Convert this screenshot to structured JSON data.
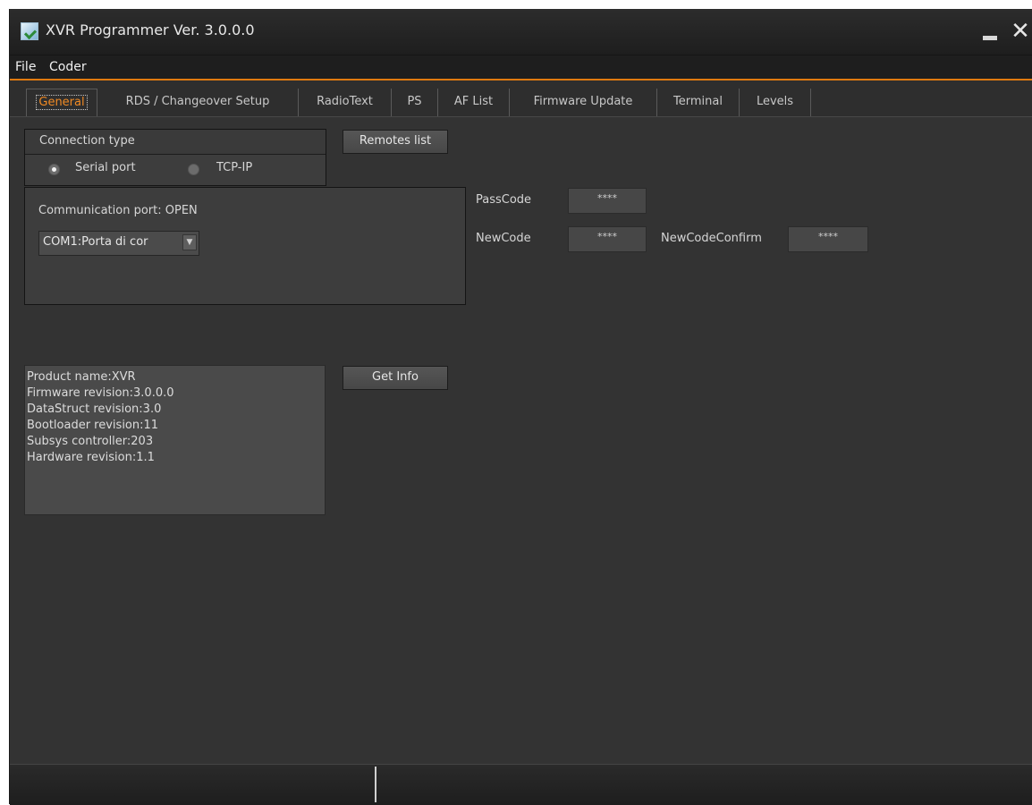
{
  "window": {
    "title": "XVR Programmer  Ver. 3.0.0.0",
    "minimize_glyph": "",
    "close_glyph": "✕"
  },
  "menu": {
    "items": [
      "File",
      "Coder"
    ]
  },
  "tabs": [
    {
      "label": "General",
      "active": true
    },
    {
      "label": "RDS / Changeover Setup",
      "active": false
    },
    {
      "label": "RadioText",
      "active": false
    },
    {
      "label": "PS",
      "active": false
    },
    {
      "label": "AF List",
      "active": false
    },
    {
      "label": "Firmware Update",
      "active": false
    },
    {
      "label": "Terminal",
      "active": false
    },
    {
      "label": "Levels",
      "active": false
    }
  ],
  "connection": {
    "title": "Connection type",
    "options": [
      {
        "label": "Serial port",
        "selected": true
      },
      {
        "label": "TCP-IP",
        "selected": false
      }
    ]
  },
  "remotes_button": "Remotes list",
  "port": {
    "status_label": "Communication port: OPEN",
    "selected_port": "COM1:Porta di cor",
    "arrow_glyph": "▼"
  },
  "codes": {
    "passcode_label": "PassCode",
    "passcode_value": "****",
    "newcode_label": "NewCode",
    "newcode_value": "****",
    "newcode_confirm_label": "NewCodeConfirm",
    "newcode_confirm_value": "****"
  },
  "info": {
    "lines": [
      "Product name:XVR",
      "Firmware revision:3.0.0.0",
      "DataStruct revision:3.0",
      "Bootloader revision:11",
      "Subsys controller:203",
      "Hardware revision:1.1"
    ],
    "get_info_button": "Get Info"
  },
  "colors": {
    "accent": "#e07a10",
    "active_tab_text": "#f08a24",
    "window_bg": "#333333",
    "panel_bg": "#3d3d3d"
  }
}
